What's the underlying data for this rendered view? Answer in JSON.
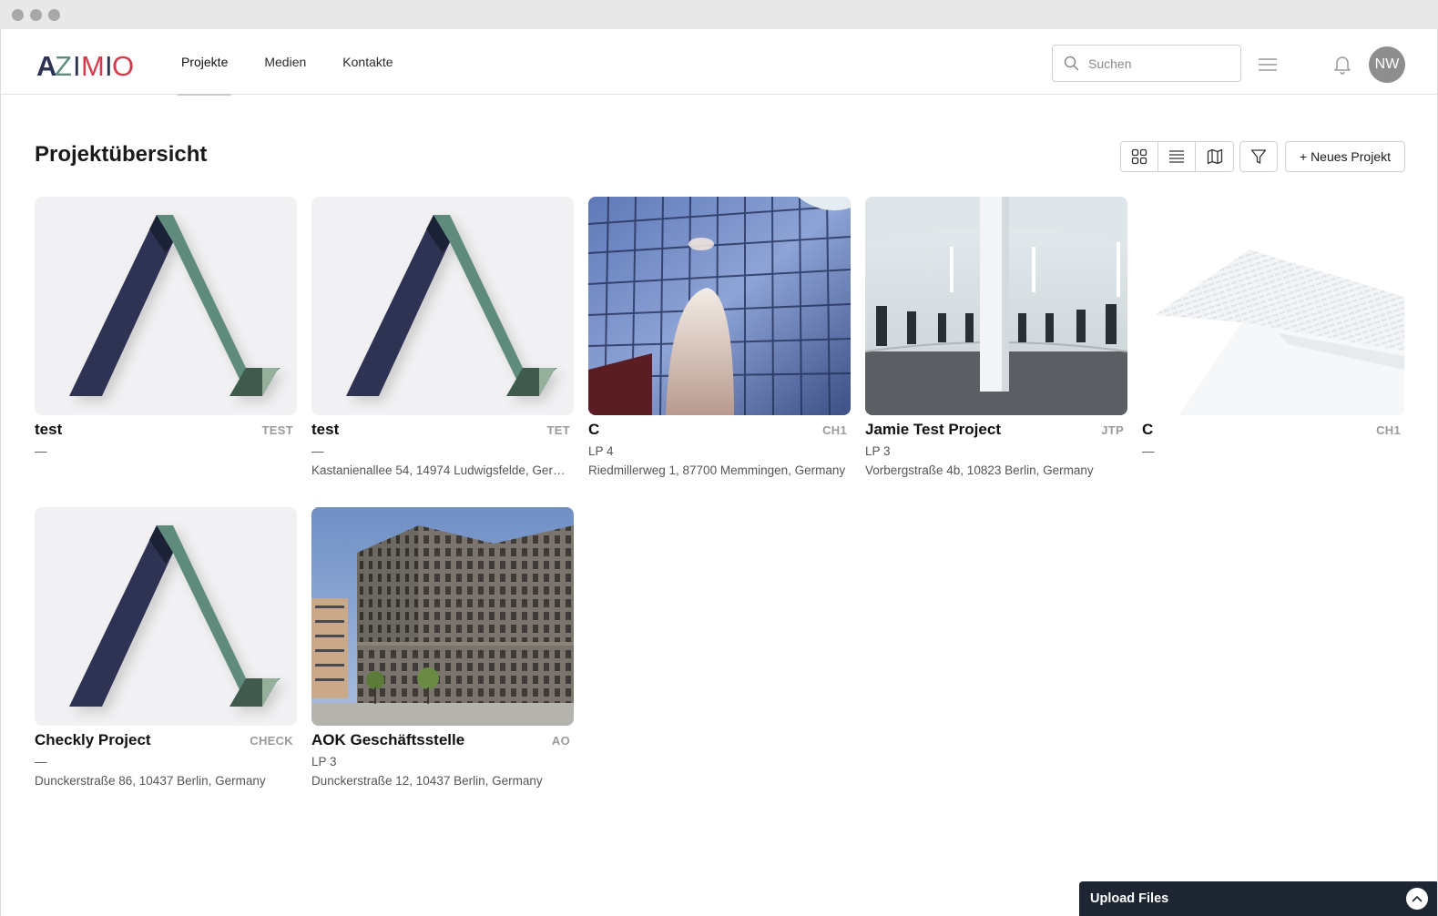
{
  "window": {
    "controls": [
      "close",
      "minimize",
      "maximize"
    ]
  },
  "header": {
    "logo_text": "AZIMIO",
    "nav": [
      {
        "label": "Projekte",
        "active": true
      },
      {
        "label": "Medien",
        "active": false
      },
      {
        "label": "Kontakte",
        "active": false
      }
    ],
    "search": {
      "placeholder": "Suchen",
      "value": ""
    },
    "icons": {
      "search": "search-icon",
      "menu": "hamburger-icon",
      "notifications": "bell-icon"
    },
    "user_initials": "NW"
  },
  "main": {
    "title": "Projektübersicht",
    "view_modes": [
      "grid-view-icon",
      "list-view-icon",
      "map-view-icon"
    ],
    "active_view": "grid",
    "filter_icon": "filter-icon",
    "new_project_label": "+ Neues Projekt"
  },
  "projects": [
    {
      "name": "test",
      "code": "TEST",
      "phase": "—",
      "address": "",
      "image": "placeholder-logo"
    },
    {
      "name": "test",
      "code": "TET",
      "phase": "—",
      "address": "Kastanienallee 54, 14974 Ludwigsfelde, Germany",
      "image": "placeholder-logo"
    },
    {
      "name": "C",
      "code": "CH1",
      "phase": "LP 4",
      "address": "Riedmillerweg 1, 87700 Memmingen, Germany",
      "image": "glass-facade-photo"
    },
    {
      "name": "Jamie Test Project",
      "code": "JTP",
      "phase": "LP 3",
      "address": "Vorbergstraße 4b, 10823 Berlin, Germany",
      "image": "round-hall-interior-photo"
    },
    {
      "name": "C",
      "code": "CH1",
      "phase": "—",
      "address": "",
      "image": "white-building-photo"
    },
    {
      "name": "Checkly Project",
      "code": "CHECK",
      "phase": "—",
      "address": "Dunckerstraße 86, 10437 Berlin, Germany",
      "image": "placeholder-logo"
    },
    {
      "name": "AOK Geschäftsstelle",
      "code": "AO",
      "phase": "LP 3",
      "address": "Dunckerstraße 12, 10437 Berlin, Germany",
      "image": "brick-office-building-photo"
    }
  ],
  "upload_panel": {
    "label": "Upload Files",
    "icon": "chevron-up-icon"
  },
  "colors": {
    "accent_navy": "#2e3352",
    "accent_green": "#5f8b7c",
    "upload_bg": "#1e2533"
  }
}
